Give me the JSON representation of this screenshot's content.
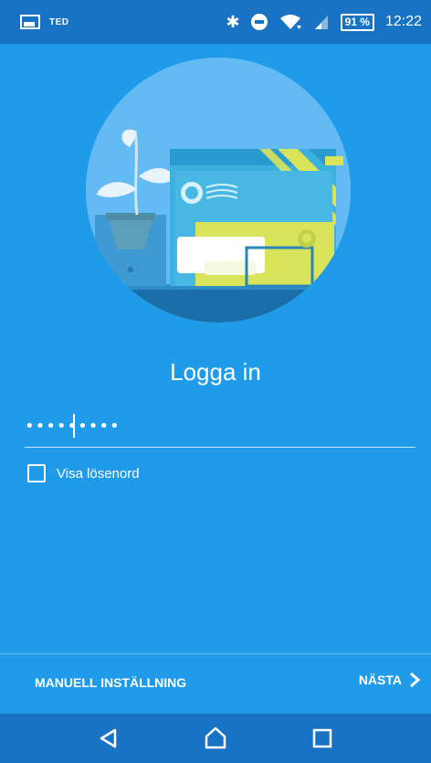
{
  "status_bar": {
    "carrier": "TED",
    "battery_level": "91 %",
    "time": "12:22"
  },
  "login": {
    "title": "Logga in",
    "password_value": "•••••••••",
    "show_password_label": "Visa lösenord"
  },
  "footer": {
    "manual_setup_label": "MANUELL INSTÄLLNING",
    "next_label": "NÄSTA"
  },
  "colors": {
    "background": "#1f9bea",
    "status_bar": "#1873c4",
    "illustration_circle": "#64bbf4",
    "envelope_yellow": "#d9e45a",
    "envelope_blue": "#49b7e3"
  },
  "icons": {
    "status": [
      "gallery-icon",
      "bluetooth-icon",
      "do-not-disturb-icon",
      "wifi-icon",
      "signal-icon",
      "battery-icon"
    ],
    "navigation": [
      "back-icon",
      "home-icon",
      "recent-apps-icon"
    ],
    "next": "chevron-right-icon"
  }
}
